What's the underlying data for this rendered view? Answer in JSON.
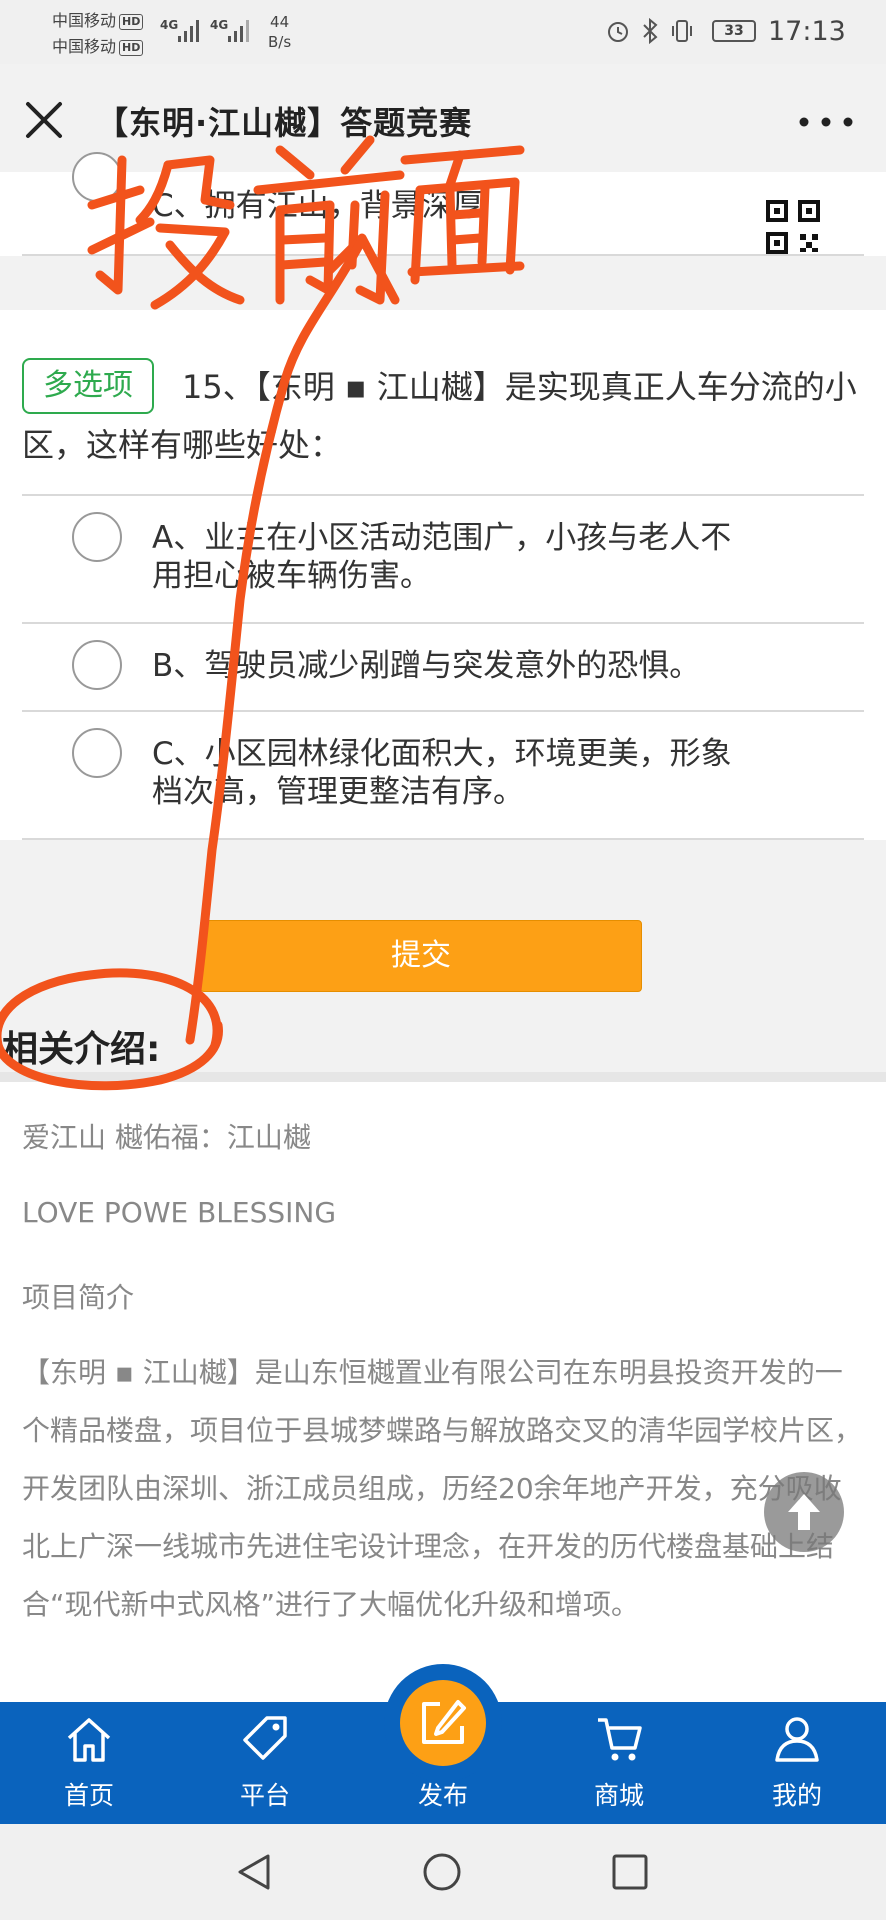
{
  "status_bar": {
    "carrier_1": "中国移动",
    "carrier_2": "中国移动",
    "hd": "HD",
    "network": "4G",
    "speed_value": "44",
    "speed_unit": "B/s",
    "battery": "33",
    "time": "17:13"
  },
  "nav": {
    "title": "【东明·江山樾】答题竞赛"
  },
  "prev_question": {
    "option_c": "C、拥有江山，背景深厚"
  },
  "question": {
    "badge": "多选项",
    "text": "15、【东明 ▪ 江山樾】是实现真正人车分流的小区，这样有哪些好处：",
    "options": [
      {
        "line1": "A、业主在小区活动范围广，小孩与老人不",
        "line2": "用担心被车辆伤害。"
      },
      {
        "line1": "B、驾驶员减少剐蹭与突发意外的恐惧。",
        "line2": ""
      },
      {
        "line1": "C、小区园林绿化面积大，环境更美，形象",
        "line2": "档次高，管理更整洁有序。"
      }
    ]
  },
  "submit_label": "提交",
  "intro": {
    "heading": "相关介绍:",
    "line_1": "爱江山 樾佑福：江山樾",
    "line_2": "LOVE POWE BLESSING",
    "line_3": "项目简介",
    "paragraph": "【东明 ▪ 江山樾】是山东恒樾置业有限公司在东明县投资开发的一个精品楼盘，项目位于县城梦蝶路与解放路交叉的清华园学校片区，开发团队由深圳、浙江成员组成，历经20余年地产开发，充分吸收北上广深一线城市先进住宅设计理念，在开发的历代楼盘基础上结合“现代新中式风格”进行了大幅优化升级和增项。"
  },
  "tabs": [
    {
      "label": "首页",
      "icon": "home-icon"
    },
    {
      "label": "平台",
      "icon": "tag-icon"
    },
    {
      "label": "发布",
      "icon": "edit-icon"
    },
    {
      "label": "商城",
      "icon": "cart-icon"
    },
    {
      "label": "我的",
      "icon": "user-icon"
    }
  ],
  "annotation_text": "投前面",
  "colors": {
    "accent_orange": "#fda015",
    "tab_blue": "#0a63bd",
    "badge_green": "#2eaa4e",
    "annotation_red": "#f2531c"
  }
}
